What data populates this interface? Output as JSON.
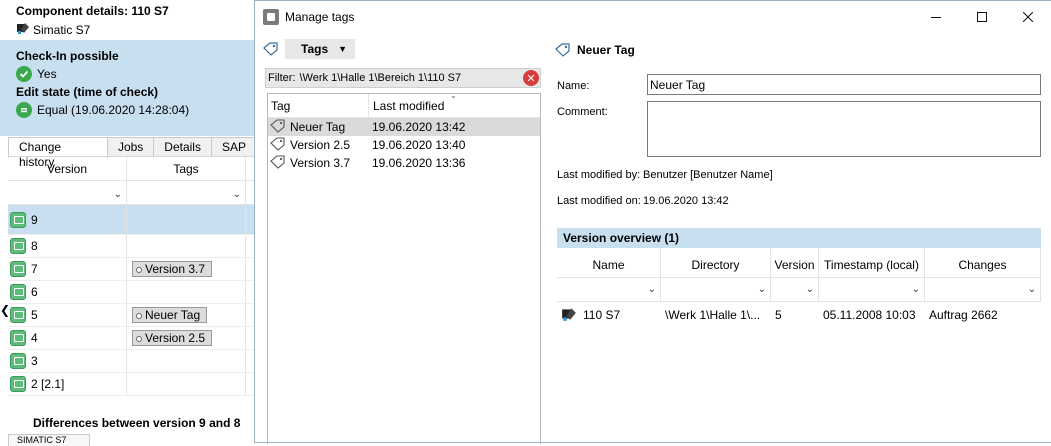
{
  "background_panel": {
    "title": "Component details: 110 S7",
    "subtitle": "Simatic S7",
    "checkin_heading": "Check-In possible",
    "checkin_value": "Yes",
    "edit_heading": "Edit state (time of check)",
    "edit_value": "Equal (19.06.2020 14:28:04)",
    "tabs": [
      "Change history",
      "Jobs",
      "Details",
      "SAP"
    ],
    "history_columns": [
      "Version",
      "Tags"
    ],
    "history_rows": [
      {
        "version": "9",
        "tag": ""
      },
      {
        "version": "8",
        "tag": ""
      },
      {
        "version": "7",
        "tag": "Version 3.7"
      },
      {
        "version": "6",
        "tag": ""
      },
      {
        "version": "5",
        "tag": "Neuer Tag"
      },
      {
        "version": "4",
        "tag": "Version 2.5"
      },
      {
        "version": "3",
        "tag": ""
      },
      {
        "version": "2 [2.1]",
        "tag": ""
      }
    ],
    "diff_title": "Differences between version 9 and 8",
    "diff_tab": "SIMATIC S7"
  },
  "dialog": {
    "title": "Manage tags",
    "window_buttons": [
      "minimize-icon",
      "maximize-icon",
      "close-icon"
    ],
    "tags_dropdown_label": "Tags",
    "filter_label": "Filter:",
    "filter_value": "\\Werk 1\\Halle 1\\Bereich 1\\110 S7",
    "tag_list": {
      "columns": [
        "Tag",
        "Last modified"
      ],
      "rows": [
        {
          "tag": "Neuer Tag",
          "modified": "19.06.2020 13:42",
          "selected": true
        },
        {
          "tag": "Version 2.5",
          "modified": "19.06.2020 13:40",
          "selected": false
        },
        {
          "tag": "Version 3.7",
          "modified": "19.06.2020 13:36",
          "selected": false
        }
      ]
    },
    "detail": {
      "title": "Neuer Tag",
      "name_label": "Name:",
      "name_value": "Neuer Tag",
      "comment_label": "Comment:",
      "comment_value": "",
      "modified_by_label": "Last modified by:",
      "modified_by_value": "Benutzer [Benutzer Name]",
      "modified_on_label": "Last modified on:",
      "modified_on_value": "19.06.2020 13:42"
    },
    "version_overview": {
      "heading": "Version overview (1)",
      "columns": [
        "Name",
        "Directory",
        "Version",
        "Timestamp (local)",
        "Changes"
      ],
      "rows": [
        {
          "name": "110 S7",
          "directory": "\\Werk 1\\Halle 1\\...",
          "version": "5",
          "timestamp": "05.11.2008 10:03",
          "changes": "Auftrag 2662"
        }
      ]
    }
  },
  "colors": {
    "accent_blue": "#c8dff0",
    "ok_green": "#3aa84c",
    "version_green": "#5fbb7c",
    "clear_red": "#d63c3c"
  }
}
